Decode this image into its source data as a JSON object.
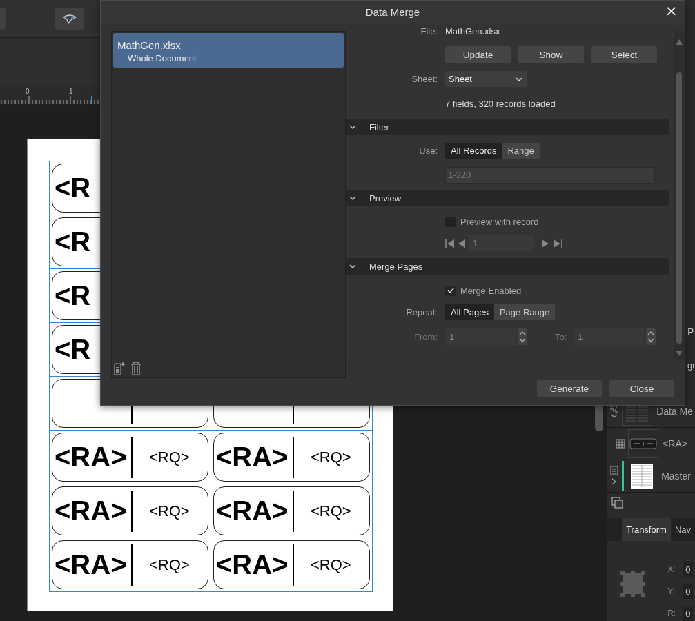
{
  "ruler": {
    "numbers": [
      "0",
      "1"
    ]
  },
  "document": {
    "rows": [
      {
        "cells": [
          {
            "ra": "<R"
          }
        ]
      },
      {
        "cells": [
          {
            "ra": "<R"
          }
        ]
      },
      {
        "cells": [
          {
            "ra": "<R"
          }
        ]
      },
      {
        "cells": [
          {
            "ra": "<R"
          }
        ]
      },
      {
        "cells": [
          {
            "kind": "covered"
          },
          {
            "kind": "covered"
          }
        ]
      },
      {
        "cells": [
          {
            "ra": "<RA>",
            "rq": "<RQ>"
          },
          {
            "ra": "<RA>",
            "rq": "<RQ>"
          }
        ]
      },
      {
        "cells": [
          {
            "ra": "<RA>",
            "rq": "<RQ>"
          },
          {
            "ra": "<RA>",
            "rq": "<RQ>"
          }
        ]
      },
      {
        "cells": [
          {
            "ra": "<RA>",
            "rq": "<RQ>"
          },
          {
            "ra": "<RA>",
            "rq": "<RQ>"
          }
        ]
      }
    ]
  },
  "right_panel": {
    "edge_texts": [
      "P",
      "gr"
    ],
    "layers": [
      {
        "name": "Data Me",
        "kind": "group"
      },
      {
        "name": "<RA>",
        "kind": "field"
      },
      {
        "name": "Master",
        "kind": "master"
      }
    ],
    "tabs": [
      {
        "label": "Transform",
        "selected": true
      },
      {
        "label": "Nav",
        "selected": false
      }
    ],
    "transform": [
      {
        "label": "X:",
        "value": "0"
      },
      {
        "label": "Y:",
        "value": "0"
      },
      {
        "label": "R:",
        "value": "0"
      }
    ]
  },
  "dialog": {
    "title": "Data Merge",
    "close": "×",
    "sources": [
      {
        "name": "MathGen.xlsx",
        "scope": "Whole Document",
        "selected": true
      }
    ],
    "file": {
      "label": "File:",
      "value": "MathGen.xlsx"
    },
    "file_buttons": [
      "Update",
      "Show",
      "Select"
    ],
    "sheet": {
      "label": "Sheet:",
      "value": "Sheet"
    },
    "status": "7 fields, 320 records loaded",
    "filter": {
      "title": "Filter",
      "expanded": true,
      "use_label": "Use:",
      "options": [
        {
          "label": "All Records",
          "selected": true
        },
        {
          "label": "Range",
          "selected": false
        }
      ],
      "range": {
        "placeholder": "1-320",
        "disabled": true
      }
    },
    "preview": {
      "title": "Preview",
      "expanded": true,
      "checkbox": {
        "label": "Preview with record",
        "checked": false
      },
      "record": "1"
    },
    "merge_pages": {
      "title": "Merge Pages",
      "expanded": true,
      "checkbox": {
        "label": "Merge Enabled",
        "checked": true
      },
      "repeat_label": "Repeat:",
      "options": [
        {
          "label": "All Pages",
          "selected": true
        },
        {
          "label": "Page Range",
          "selected": false
        }
      ],
      "range_disabled": true,
      "from": {
        "label": "From:",
        "value": "1"
      },
      "to": {
        "label": "To:",
        "value": "1"
      }
    },
    "buttons": [
      "Generate",
      "Close"
    ]
  }
}
